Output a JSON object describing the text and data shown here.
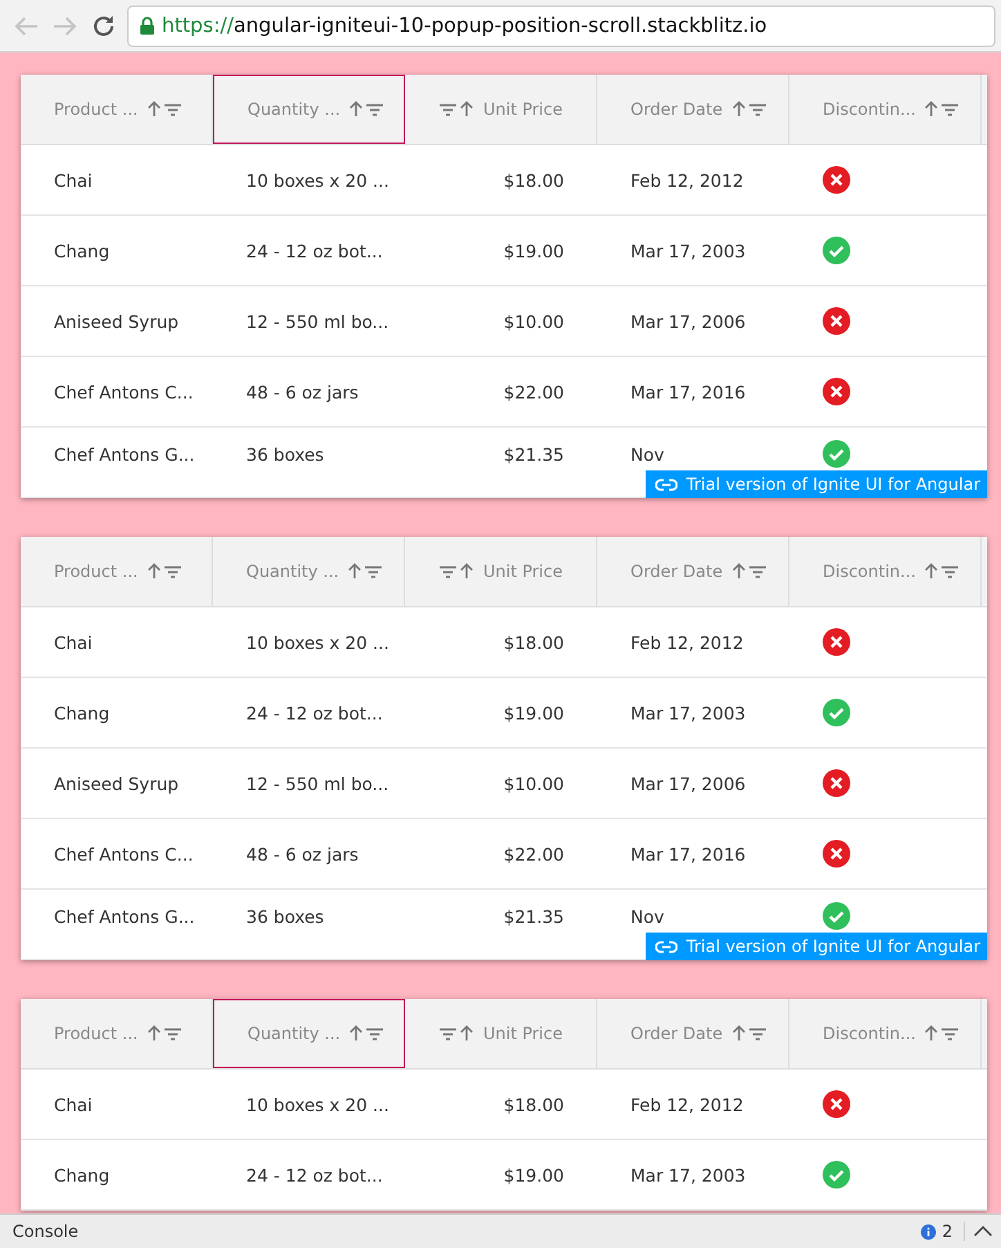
{
  "browser": {
    "back_disabled": true,
    "forward_disabled": true,
    "url_protocol": "https://",
    "url_host": "angular-igniteui-10-popup-position-scroll.stackblitz.io"
  },
  "grids": [
    {
      "columns": [
        {
          "label": "Product ...",
          "selected": false,
          "numeric": false
        },
        {
          "label": "Quantity ...",
          "selected": true,
          "numeric": false
        },
        {
          "label": "Unit Price",
          "selected": false,
          "numeric": true
        },
        {
          "label": "Order Date",
          "selected": false,
          "numeric": false
        },
        {
          "label": "Discontin...",
          "selected": false,
          "numeric": false
        }
      ],
      "rows": [
        {
          "product": "Chai",
          "quantity": "10 boxes x 20 ...",
          "price": "$18.00",
          "date": "Feb 12, 2012",
          "discontinued": true
        },
        {
          "product": "Chang",
          "quantity": "24 - 12 oz bot...",
          "price": "$19.00",
          "date": "Mar 17, 2003",
          "discontinued": false
        },
        {
          "product": "Aniseed Syrup",
          "quantity": "12 - 550 ml bo...",
          "price": "$10.00",
          "date": "Mar 17, 2006",
          "discontinued": true
        },
        {
          "product": "Chef Antons C...",
          "quantity": "48 - 6 oz jars",
          "price": "$22.00",
          "date": "Mar 17, 2016",
          "discontinued": true
        },
        {
          "product": "Chef Antons G...",
          "quantity": "36 boxes",
          "price": "$21.35",
          "date": "Nov",
          "discontinued": false
        }
      ],
      "trial_badge": "Trial version of Ignite UI for Angular"
    },
    {
      "columns": [
        {
          "label": "Product ...",
          "selected": false,
          "numeric": false
        },
        {
          "label": "Quantity ...",
          "selected": false,
          "numeric": false
        },
        {
          "label": "Unit Price",
          "selected": false,
          "numeric": true
        },
        {
          "label": "Order Date",
          "selected": false,
          "numeric": false
        },
        {
          "label": "Discontin...",
          "selected": false,
          "numeric": false
        }
      ],
      "rows": [
        {
          "product": "Chai",
          "quantity": "10 boxes x 20 ...",
          "price": "$18.00",
          "date": "Feb 12, 2012",
          "discontinued": true
        },
        {
          "product": "Chang",
          "quantity": "24 - 12 oz bot...",
          "price": "$19.00",
          "date": "Mar 17, 2003",
          "discontinued": false
        },
        {
          "product": "Aniseed Syrup",
          "quantity": "12 - 550 ml bo...",
          "price": "$10.00",
          "date": "Mar 17, 2006",
          "discontinued": true
        },
        {
          "product": "Chef Antons C...",
          "quantity": "48 - 6 oz jars",
          "price": "$22.00",
          "date": "Mar 17, 2016",
          "discontinued": true
        },
        {
          "product": "Chef Antons G...",
          "quantity": "36 boxes",
          "price": "$21.35",
          "date": "Nov",
          "discontinued": false
        }
      ],
      "trial_badge": "Trial version of Ignite UI for Angular"
    },
    {
      "columns": [
        {
          "label": "Product ...",
          "selected": false,
          "numeric": false
        },
        {
          "label": "Quantity ...",
          "selected": true,
          "numeric": false
        },
        {
          "label": "Unit Price",
          "selected": false,
          "numeric": true
        },
        {
          "label": "Order Date",
          "selected": false,
          "numeric": false
        },
        {
          "label": "Discontin...",
          "selected": false,
          "numeric": false
        }
      ],
      "rows": [
        {
          "product": "Chai",
          "quantity": "10 boxes x 20 ...",
          "price": "$18.00",
          "date": "Feb 12, 2012",
          "discontinued": true
        },
        {
          "product": "Chang",
          "quantity": "24 - 12 oz bot...",
          "price": "$19.00",
          "date": "Mar 17, 2003",
          "discontinued": false
        }
      ]
    }
  ],
  "console": {
    "label": "Console",
    "message_count": "2"
  }
}
